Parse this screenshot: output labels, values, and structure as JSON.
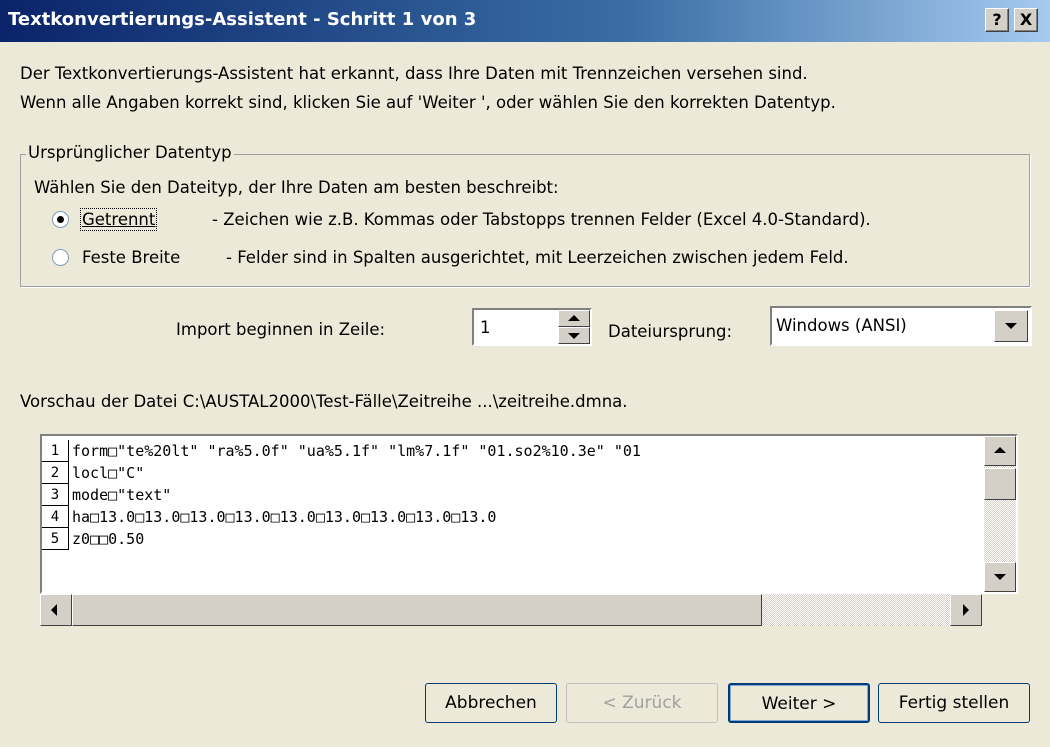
{
  "window": {
    "title": "Textkonvertierungs-Assistent - Schritt 1 von 3",
    "help_label": "?",
    "close_label": "X"
  },
  "intro": {
    "line1": "Der Textkonvertierungs-Assistent hat erkannt, dass Ihre Daten mit Trennzeichen versehen sind.",
    "line2": "Wenn alle Angaben korrekt sind, klicken Sie auf 'Weiter ', oder wählen Sie den korrekten Datentyp."
  },
  "datatype_group": {
    "legend": "Ursprünglicher Datentyp",
    "prompt": "Wählen Sie den Dateityp, der Ihre Daten am besten beschreibt:",
    "options": [
      {
        "label": "Getrennt",
        "description": "- Zeichen wie z.B. Kommas oder Tabstopps trennen Felder (Excel 4.0-Standard).",
        "selected": true
      },
      {
        "label": "Feste Breite",
        "description": "- Felder sind in Spalten ausgerichtet, mit Leerzeichen zwischen jedem Feld.",
        "selected": false
      }
    ]
  },
  "import_row": {
    "start_label": "Import beginnen in Zeile:",
    "start_value": "1",
    "origin_label": "Dateiursprung:",
    "origin_value": "Windows (ANSI)"
  },
  "preview": {
    "label": "Vorschau der Datei C:\\AUSTAL2000\\Test-Fälle\\Zeitreihe ...\\zeitreihe.dmna.",
    "rows": [
      {
        "num": "1",
        "text": "form□\"te%20lt\" \"ra%5.0f\" \"ua%5.1f\" \"lm%7.1f\" \"01.so2%10.3e\" \"01"
      },
      {
        "num": "2",
        "text": "locl□\"C\""
      },
      {
        "num": "3",
        "text": "mode□\"text\""
      },
      {
        "num": "4",
        "text": "ha□13.0□13.0□13.0□13.0□13.0□13.0□13.0□13.0□13.0"
      },
      {
        "num": "5",
        "text": "z0□□0.50"
      }
    ]
  },
  "buttons": {
    "cancel": "Abbrechen",
    "back": "< Zurück",
    "next": "Weiter >",
    "finish": "Fertig stellen"
  }
}
